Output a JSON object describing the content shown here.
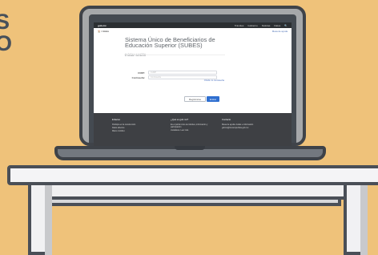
{
  "side_text": {
    "line1": "S",
    "line2": "O"
  },
  "site": {
    "brand": "gob.mx",
    "nav": [
      "Trámites",
      "Gobierno",
      "Noticias",
      "Datos",
      "🔍"
    ],
    "home_label": "🏠 > Inicio",
    "help_link": "Mesa de ayuda"
  },
  "page": {
    "title": "Sistema Único de Beneficiarios de Educación Superior (SUBES)",
    "login_heading": "Iniciar sesión",
    "curp_label": "CURP:",
    "curp_placeholder": "CURP",
    "password_label": "Contraseña:",
    "password_placeholder": "Contraseña",
    "forgot_link": "Olvidé mi contraseña",
    "register_button": "Registrarse",
    "enter_button": "Entrar"
  },
  "footer": {
    "col1": {
      "heading": "Enlaces",
      "lines": [
        "Participa en la construcción",
        "Datos abiertos",
        "Marco Jurídico"
      ]
    },
    "col2": {
      "heading": "¿Qué es gob.mx?",
      "lines": [
        "Es el portal único de trámites, información y participación",
        "ciudadana. Leer más"
      ]
    },
    "col3": {
      "heading": "Contacto",
      "lines": [
        "Mesa de ayuda: dudas e información",
        "gobmx@funcionpublica.gob.mx"
      ]
    }
  }
}
